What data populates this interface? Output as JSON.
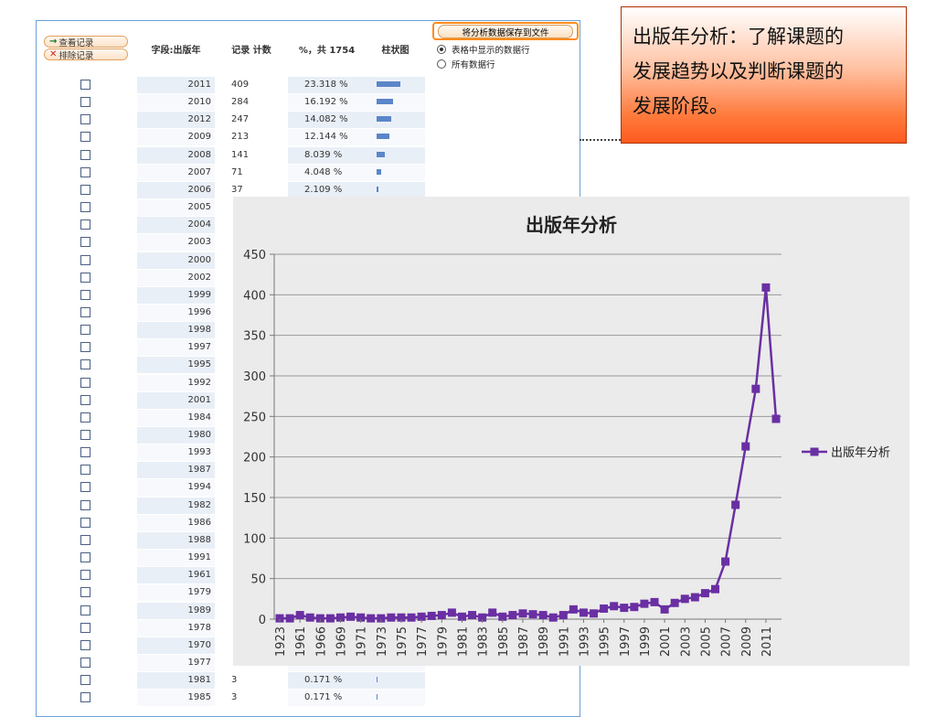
{
  "table": {
    "buttons": {
      "view_records": "查看记录",
      "exclude_records": "排除记录",
      "view_icon": "→",
      "exclude_icon": "✕"
    },
    "headers": {
      "field": "字段:出版年",
      "count": "记录 计数",
      "percent": "%，共 1754",
      "bar": "柱状图"
    },
    "save_button": "将分析数据保存到文件",
    "radio_options": [
      "表格中显示的数据行",
      "所有数据行"
    ],
    "rows": [
      {
        "year": "2011",
        "count": "409",
        "pct": "23.318 %",
        "bar": 0.23318
      },
      {
        "year": "2010",
        "count": "284",
        "pct": "16.192 %",
        "bar": 0.16192
      },
      {
        "year": "2012",
        "count": "247",
        "pct": "14.082 %",
        "bar": 0.14082
      },
      {
        "year": "2009",
        "count": "213",
        "pct": "12.144 %",
        "bar": 0.12144
      },
      {
        "year": "2008",
        "count": "141",
        "pct": "8.039 %",
        "bar": 0.08039
      },
      {
        "year": "2007",
        "count": "71",
        "pct": "4.048 %",
        "bar": 0.04048
      },
      {
        "year": "2006",
        "count": "37",
        "pct": "2.109 %",
        "bar": 0.02109
      },
      {
        "year": "2005",
        "count": "",
        "pct": "",
        "bar": 0
      },
      {
        "year": "2004",
        "count": "",
        "pct": "",
        "bar": 0
      },
      {
        "year": "2003",
        "count": "",
        "pct": "",
        "bar": 0
      },
      {
        "year": "2000",
        "count": "",
        "pct": "",
        "bar": 0
      },
      {
        "year": "2002",
        "count": "",
        "pct": "",
        "bar": 0
      },
      {
        "year": "1999",
        "count": "",
        "pct": "",
        "bar": 0
      },
      {
        "year": "1996",
        "count": "",
        "pct": "",
        "bar": 0
      },
      {
        "year": "1998",
        "count": "",
        "pct": "",
        "bar": 0
      },
      {
        "year": "1997",
        "count": "",
        "pct": "",
        "bar": 0
      },
      {
        "year": "1995",
        "count": "",
        "pct": "",
        "bar": 0
      },
      {
        "year": "1992",
        "count": "",
        "pct": "",
        "bar": 0
      },
      {
        "year": "2001",
        "count": "",
        "pct": "",
        "bar": 0
      },
      {
        "year": "1984",
        "count": "",
        "pct": "",
        "bar": 0
      },
      {
        "year": "1980",
        "count": "",
        "pct": "",
        "bar": 0
      },
      {
        "year": "1993",
        "count": "",
        "pct": "",
        "bar": 0
      },
      {
        "year": "1987",
        "count": "",
        "pct": "",
        "bar": 0
      },
      {
        "year": "1994",
        "count": "",
        "pct": "",
        "bar": 0
      },
      {
        "year": "1982",
        "count": "",
        "pct": "",
        "bar": 0
      },
      {
        "year": "1986",
        "count": "",
        "pct": "",
        "bar": 0
      },
      {
        "year": "1988",
        "count": "",
        "pct": "",
        "bar": 0
      },
      {
        "year": "1991",
        "count": "",
        "pct": "",
        "bar": 0
      },
      {
        "year": "1961",
        "count": "",
        "pct": "",
        "bar": 0
      },
      {
        "year": "1979",
        "count": "",
        "pct": "",
        "bar": 0
      },
      {
        "year": "1989",
        "count": "",
        "pct": "",
        "bar": 0
      },
      {
        "year": "1978",
        "count": "",
        "pct": "",
        "bar": 0
      },
      {
        "year": "1970",
        "count": "",
        "pct": "",
        "bar": 0
      },
      {
        "year": "1977",
        "count": "",
        "pct": "",
        "bar": 0
      },
      {
        "year": "1981",
        "count": "3",
        "pct": "0.171 %",
        "bar": 0.00171
      },
      {
        "year": "1985",
        "count": "3",
        "pct": "0.171 %",
        "bar": 0.00171
      }
    ]
  },
  "callout": {
    "lines": [
      "出版年分析：了解课题的",
      "发展趋势以及判断课题的",
      "发展阶段。"
    ]
  },
  "colors": {
    "series": "#6a2fa3",
    "callout_bottom": "#ff5a1e",
    "save_border": "#ff8c1a",
    "table_bar": "#5b86c9"
  },
  "chart_data": {
    "type": "line",
    "title": "出版年分析",
    "xlabel": "",
    "ylabel": "",
    "ylim": [
      0,
      450
    ],
    "yticks": [
      0,
      50,
      100,
      150,
      200,
      250,
      300,
      350,
      400,
      450
    ],
    "grid": true,
    "legend": "right",
    "x": [
      "1923",
      "1961",
      "1966",
      "1969",
      "1971",
      "1973",
      "1975",
      "1977",
      "1979",
      "1981",
      "1983",
      "1985",
      "1987",
      "1989",
      "1991",
      "1993",
      "1995",
      "1997",
      "1999",
      "2001",
      "2003",
      "2005",
      "2007",
      "2009",
      "2011"
    ],
    "x_tick_labels": [
      "1923",
      "1961",
      "1966",
      "1969",
      "1971",
      "1973",
      "1975",
      "1977",
      "1979",
      "1981",
      "1983",
      "1985",
      "1987",
      "1989",
      "1991",
      "1993",
      "1995",
      "1997",
      "1999",
      "2001",
      "2003",
      "2005",
      "2007",
      "2009",
      "2011"
    ],
    "series": [
      {
        "name": "出版年分析",
        "values": [
          1,
          1,
          5,
          2,
          1,
          1,
          2,
          3,
          2,
          1,
          1,
          2,
          2,
          2,
          3,
          4,
          5,
          8,
          3,
          5,
          2,
          8,
          3,
          5,
          7,
          6,
          5,
          2,
          5,
          12,
          8,
          7,
          13,
          16,
          14,
          15,
          19,
          21,
          12,
          20,
          25,
          27,
          32,
          37,
          71,
          141,
          213,
          284,
          409,
          247
        ]
      }
    ]
  }
}
